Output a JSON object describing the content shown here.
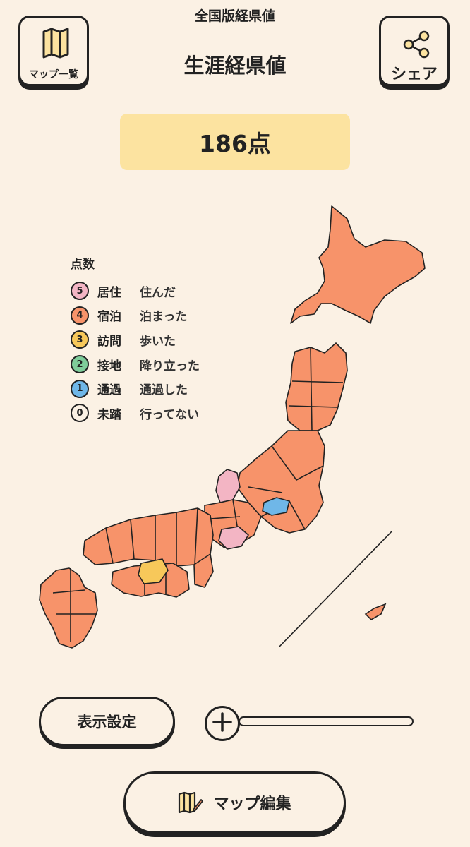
{
  "app_title": "全国版経県値",
  "page_title": "生涯経県値",
  "header": {
    "map_list_label": "マップ一覧",
    "map_list_icon": "map-icon",
    "share_label": "シェア",
    "share_icon": "share-icon"
  },
  "score": "186点",
  "legend": {
    "title": "点数",
    "items": [
      {
        "score": "5",
        "level": "居住",
        "desc": "住んだ",
        "color": "#f3b5c4"
      },
      {
        "score": "4",
        "level": "宿泊",
        "desc": "泊まった",
        "color": "#f7936a"
      },
      {
        "score": "3",
        "level": "訪問",
        "desc": "歩いた",
        "color": "#f7c85a"
      },
      {
        "score": "2",
        "level": "接地",
        "desc": "降り立った",
        "color": "#7fcd9a"
      },
      {
        "score": "1",
        "level": "通過",
        "desc": "通過した",
        "color": "#6fb7e8"
      },
      {
        "score": "0",
        "level": "未踏",
        "desc": "行ってない",
        "color": "#fbf1e4"
      }
    ]
  },
  "map": {
    "base_color": "#f7936a",
    "lived_color": "#f3b5c4",
    "visited_color": "#f7c85a",
    "passed_color": "#6fb7e8"
  },
  "controls": {
    "display_settings_label": "表示設定",
    "zoom_icon": "plus-icon",
    "zoom_level": 0,
    "edit_map_label": "マップ編集",
    "edit_icon": "map-edit-icon"
  }
}
